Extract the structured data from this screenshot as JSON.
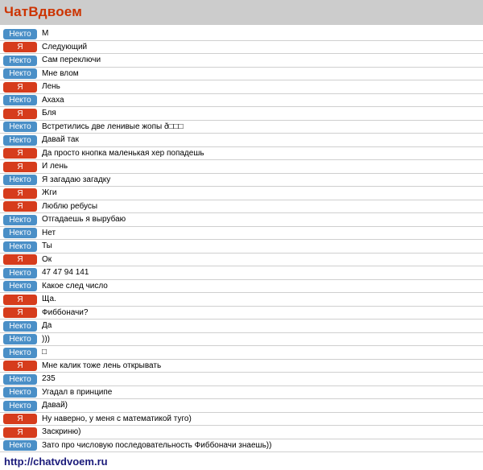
{
  "header": {
    "title": "ЧатВдвоем"
  },
  "labels": {
    "stranger": "Некто",
    "me": "Я"
  },
  "colors": {
    "stranger": "#4a8fc7",
    "me": "#d63c1c",
    "brand": "#cc3300"
  },
  "messages": [
    {
      "from": "stranger",
      "text": "М"
    },
    {
      "from": "me",
      "text": "Следующий"
    },
    {
      "from": "stranger",
      "text": "Сам переключи"
    },
    {
      "from": "stranger",
      "text": "Мне влом"
    },
    {
      "from": "me",
      "text": "Лень"
    },
    {
      "from": "stranger",
      "text": "Ахаха"
    },
    {
      "from": "me",
      "text": "Бля"
    },
    {
      "from": "stranger",
      "text": "Встретились две ленивые жопы ð□□□"
    },
    {
      "from": "stranger",
      "text": "Давай так"
    },
    {
      "from": "me",
      "text": "Да просто кнопка маленькая хер попадешь"
    },
    {
      "from": "me",
      "text": "И лень"
    },
    {
      "from": "stranger",
      "text": "Я загадаю загадку"
    },
    {
      "from": "me",
      "text": "Жги"
    },
    {
      "from": "me",
      "text": "Люблю ребусы"
    },
    {
      "from": "stranger",
      "text": "Отгадаешь я вырубаю"
    },
    {
      "from": "stranger",
      "text": "Нет"
    },
    {
      "from": "stranger",
      "text": "Ты"
    },
    {
      "from": "me",
      "text": "Ок"
    },
    {
      "from": "stranger",
      "text": "47 47 94 141"
    },
    {
      "from": "stranger",
      "text": "Какое след число"
    },
    {
      "from": "me",
      "text": "Ща."
    },
    {
      "from": "me",
      "text": "Фиббоначи?"
    },
    {
      "from": "stranger",
      "text": "Да"
    },
    {
      "from": "stranger",
      "text": ")))"
    },
    {
      "from": "stranger",
      "text": "□"
    },
    {
      "from": "me",
      "text": "Мне калик тоже лень открывать"
    },
    {
      "from": "stranger",
      "text": "235"
    },
    {
      "from": "stranger",
      "text": "Угадал в принципе"
    },
    {
      "from": "stranger",
      "text": "Давай)"
    },
    {
      "from": "me",
      "text": "Ну наверно, у меня с математикой туго)"
    },
    {
      "from": "me",
      "text": "Заскриню)"
    },
    {
      "from": "stranger",
      "text": "Зато про числовую последовательность Фиббоначи знаешь))"
    }
  ],
  "footer": {
    "url": "http://chatvdvoem.ru"
  }
}
